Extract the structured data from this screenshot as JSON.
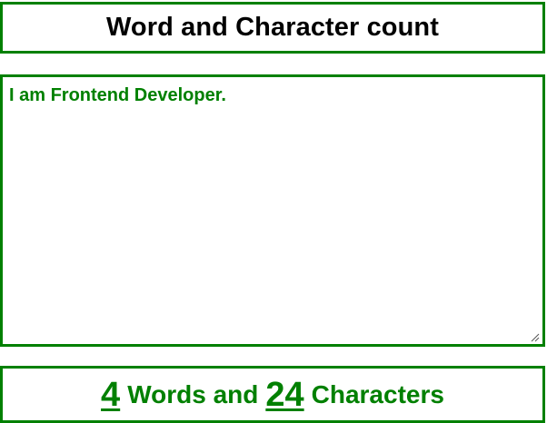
{
  "header": {
    "title": "Word and Character count"
  },
  "editor": {
    "value": "I am Frontend Developer."
  },
  "result": {
    "word_count": "4",
    "words_label": "Words and",
    "char_count": "24",
    "chars_label": "Characters"
  },
  "icons": {
    "resize_handle": "resize-handle-icon"
  },
  "colors": {
    "accent": "#008000",
    "title": "#000000",
    "background": "#ffffff"
  }
}
